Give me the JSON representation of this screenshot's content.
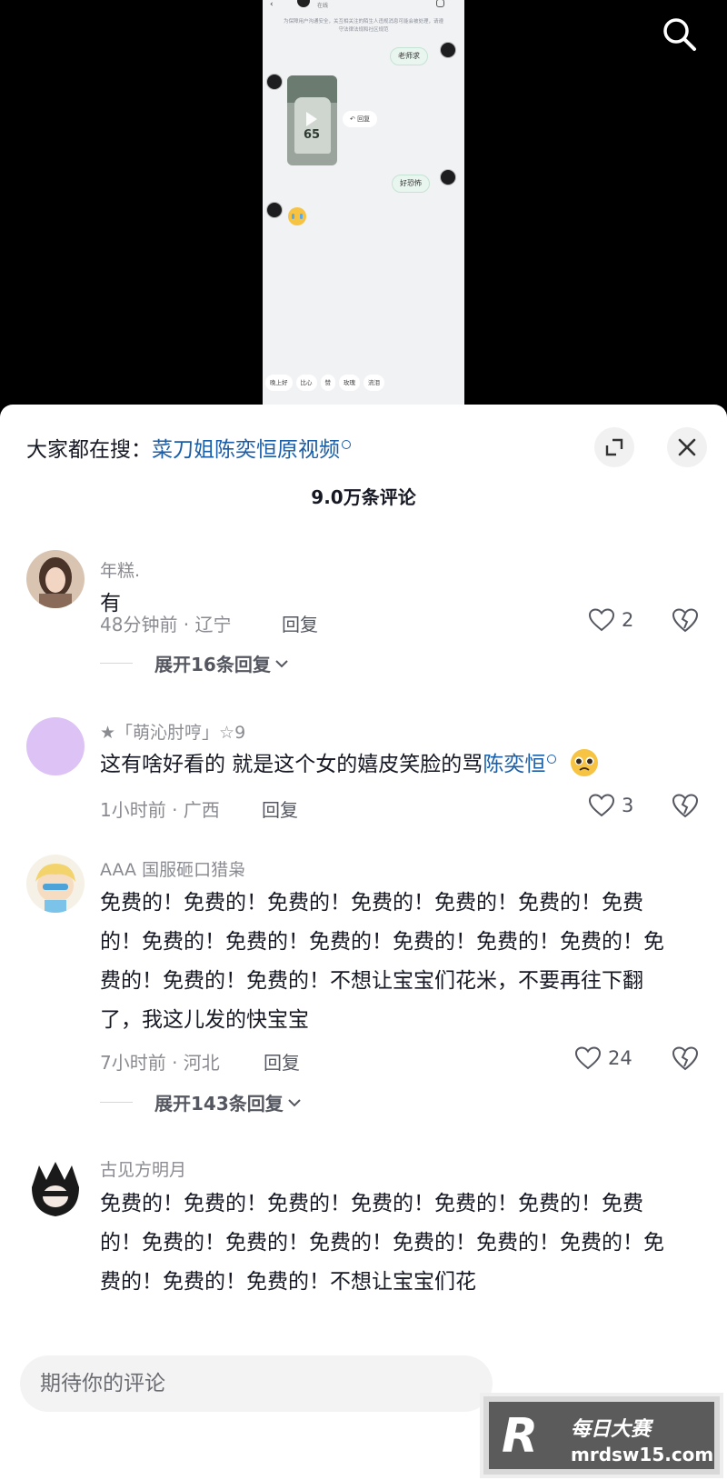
{
  "video": {
    "chat_notice": "为保障用户沟通安全，关互相关注的陌生人违规消息可能会被处理，请遵守法律法规和社区规范",
    "chat_status": "在线",
    "bubble_1": "老师求",
    "reply_tag": "回复",
    "bubble_2": "好恐怖",
    "thumb_number": "65",
    "quick_replies": [
      "晚上好",
      "比心",
      "赞",
      "玫瑰",
      "流泪"
    ]
  },
  "panel": {
    "search_prefix": "大家都在搜：",
    "search_keyword": "菜刀姐陈奕恒原视频",
    "comment_count": "9.0万条评论"
  },
  "comments": [
    {
      "username": "年糕.",
      "text": "有",
      "meta": "48分钟前 · 辽宁",
      "reply_label": "回复",
      "likes": "2",
      "expand": "展开16条回复",
      "avatar_color": "#c7a78e"
    },
    {
      "username": "★「萌沁肘哼」☆9",
      "text": "这有啥好看的 就是这个女的嬉皮笑脸的骂",
      "link": "陈奕恒",
      "meta": "1小时前 · 广西",
      "reply_label": "回复",
      "likes": "3",
      "avatar_color": "#dcc2f5"
    },
    {
      "username": "AAA 国服砸口猎枭",
      "text": "免费的！免费的！免费的！免费的！免费的！免费的！免费的！免费的！免费的！免费的！免费的！免费的！免费的！免费的！免费的！免费的！不想让宝宝们花米，不要再往下翻了，我这儿发的快宝宝",
      "meta": "7小时前 · 河北",
      "reply_label": "回复",
      "likes": "24",
      "expand": "展开143条回复",
      "avatar_color": "#f3d36b"
    },
    {
      "username": "古见方明月",
      "text": "免费的！免费的！免费的！免费的！免费的！免费的！免费的！免费的！免费的！免费的！免费的！免费的！免费的！免费的！免费的！免费的！不想让宝宝们花",
      "avatar_color": "#1a1a1a"
    }
  ],
  "input": {
    "placeholder": "期待你的评论"
  },
  "watermark": {
    "line1": "每日大赛",
    "line2": "mrdsw15.com",
    "letter": "R"
  }
}
